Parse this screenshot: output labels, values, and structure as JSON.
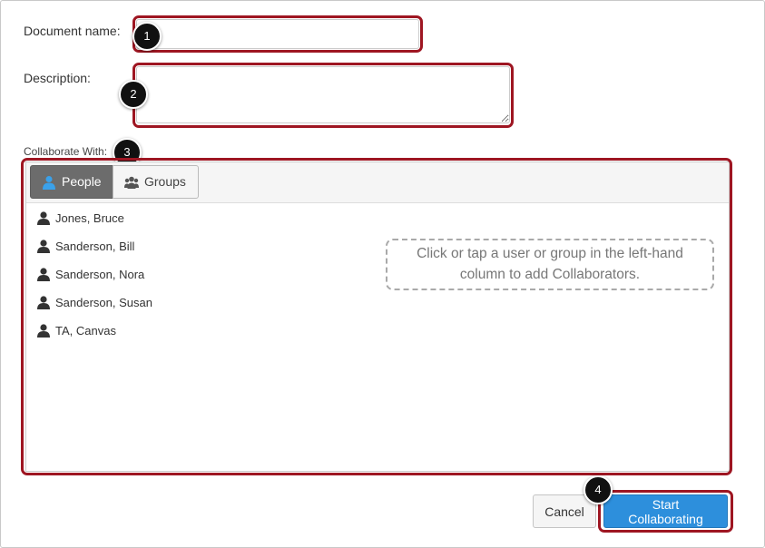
{
  "form": {
    "document_name_label": "Document name:",
    "document_name_value": "",
    "description_label": "Description:",
    "description_value": "",
    "collaborate_label": "Collaborate With:"
  },
  "collaborators": {
    "tabs": [
      {
        "label": "People",
        "icon": "person-icon",
        "active": true
      },
      {
        "label": "Groups",
        "icon": "group-icon",
        "active": false
      }
    ],
    "users": [
      {
        "name": "Jones, Bruce"
      },
      {
        "name": "Sanderson, Bill"
      },
      {
        "name": "Sanderson, Nora"
      },
      {
        "name": "Sanderson, Susan"
      },
      {
        "name": "TA, Canvas"
      }
    ],
    "hint_line1": "Click or tap a user or group in the left-hand",
    "hint_line2": "column to add Collaborators."
  },
  "actions": {
    "cancel_label": "Cancel",
    "start_label": "Start Collaborating"
  },
  "callouts": [
    "1",
    "2",
    "3",
    "4"
  ],
  "colors": {
    "callout_outline": "#9e1622",
    "primary": "#2d8fdc",
    "active_tab": "#6c6c6c",
    "user_icon": "#333333",
    "people_icon": "#3aa1ea"
  }
}
